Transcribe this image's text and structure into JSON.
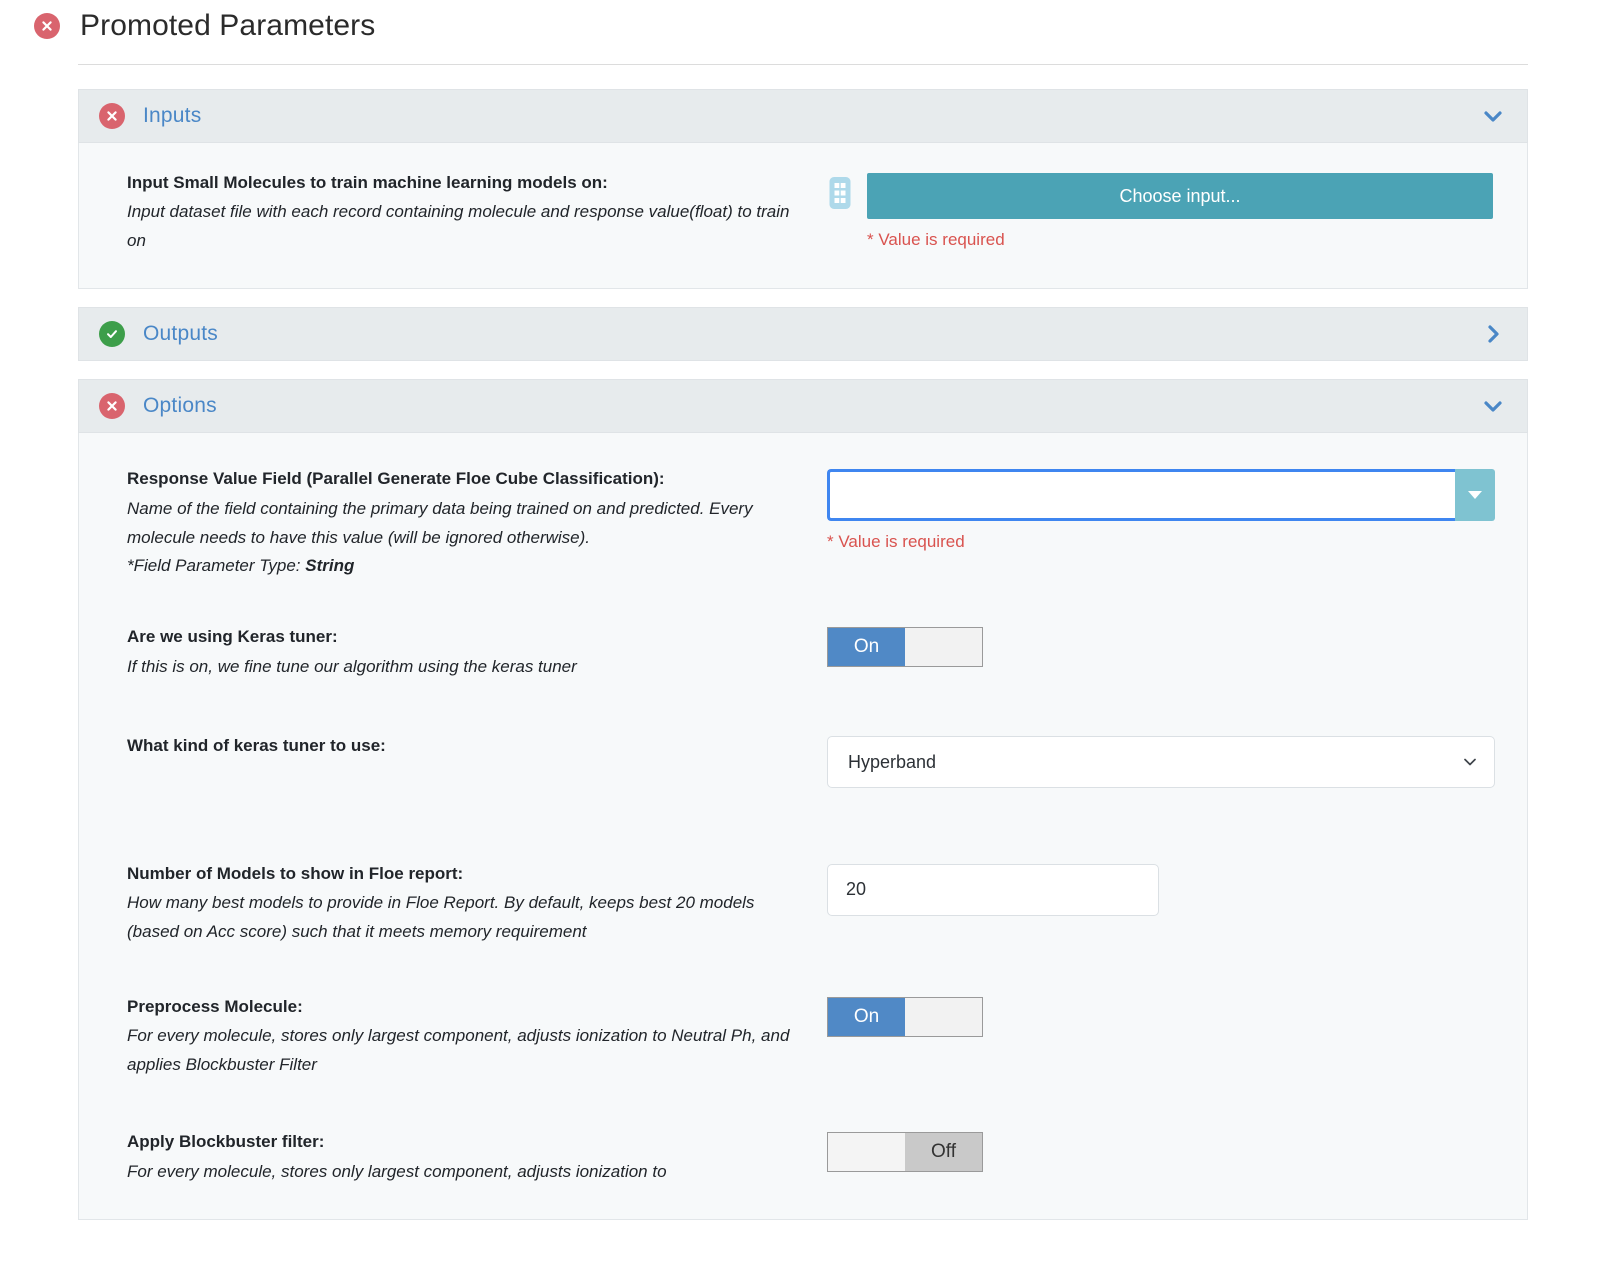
{
  "page": {
    "title": "Promoted Parameters",
    "title_status": "error"
  },
  "required_text": "* Value is required",
  "sections": [
    {
      "id": "inputs",
      "label": "Inputs",
      "status": "error",
      "expanded": true,
      "chevron": "chevron-down-icon"
    },
    {
      "id": "outputs",
      "label": "Outputs",
      "status": "ok",
      "expanded": false,
      "chevron": "chevron-right-icon"
    },
    {
      "id": "options",
      "label": "Options",
      "status": "error",
      "expanded": true,
      "chevron": "chevron-down-icon"
    }
  ],
  "inputs": {
    "param": {
      "label": "Input Small Molecules to train machine learning models on:",
      "description": "Input dataset file with each record containing molecule and response value(float) to train on",
      "dataset_icon": "dataset-icon",
      "choose_button": "Choose input...",
      "error": "* Value is required"
    }
  },
  "options": {
    "response_field": {
      "label": "Response Value Field (Parallel Generate Floe Cube Classification):",
      "description_line1": "Name of the field containing the primary data being trained on and predicted. Every molecule needs to have this value (will be ignored otherwise).",
      "description_line2_prefix": "*Field Parameter Type: ",
      "description_line2_bold": "String",
      "value": "",
      "placeholder": "",
      "error": "* Value is required"
    },
    "keras_tuner": {
      "label": "Are we using Keras tuner:",
      "description": "If this is on, we fine tune our algorithm using the keras tuner",
      "state": "On",
      "on_label": "On",
      "off_label": ""
    },
    "tuner_kind": {
      "label": "What kind of keras tuner to use:",
      "description": "",
      "value": "Hyperband",
      "options": [
        "Hyperband"
      ]
    },
    "num_models": {
      "label": "Number of Models to show in Floe report:",
      "description": "How many best models to provide in Floe Report. By default, keeps best 20 models (based on Acc score) such that it meets memory requirement",
      "value": "20"
    },
    "preprocess": {
      "label": "Preprocess Molecule:",
      "description": "For every molecule, stores only largest component, adjusts ionization to Neutral Ph, and applies Blockbuster Filter",
      "state": "On",
      "on_label": "On",
      "off_label": ""
    },
    "blockbuster": {
      "label": "Apply Blockbuster filter:",
      "description": "For every molecule, stores only largest component, adjusts ionization to",
      "state": "Off",
      "on_label": "",
      "off_label": "Off"
    }
  },
  "colors": {
    "accent_teal": "#4ba3b5",
    "link_blue": "#4a87c7",
    "error_red": "#d9534f",
    "badge_error": "#d9646e",
    "badge_ok": "#3d9e4a",
    "toggle_on": "#5089c6",
    "toggle_off": "#c9c9c9",
    "panel_header": "#e7ebed",
    "panel_body": "#f7f9fa",
    "focus_border": "#3f86f0"
  }
}
